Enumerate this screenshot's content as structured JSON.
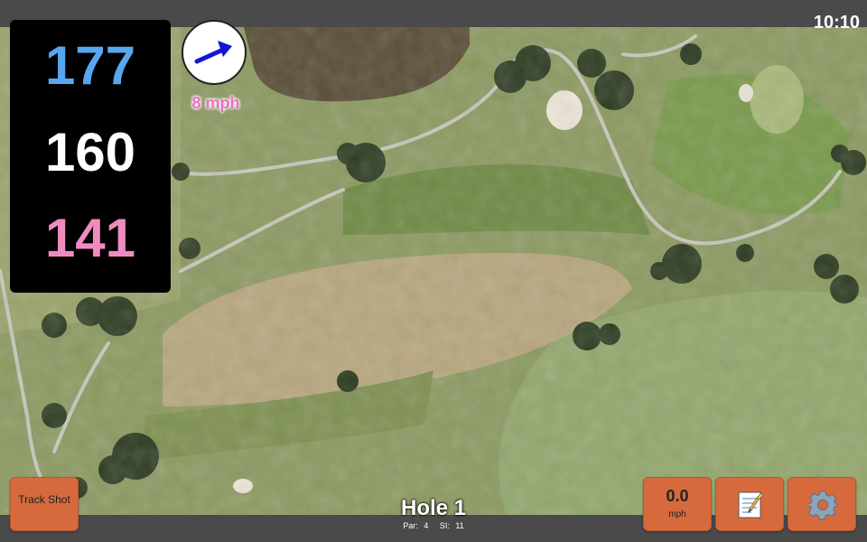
{
  "status_bar": {
    "time": "10:10"
  },
  "distances": {
    "back": "177",
    "middle": "160",
    "front": "141"
  },
  "wind": {
    "speed": "8 mph",
    "direction_icon": "arrow-east-northeast"
  },
  "hole": {
    "title": "Hole 1",
    "par": "Par: 4",
    "stroke_index": "SI: 11"
  },
  "buttons": {
    "track_shot": "Track Shot",
    "speed_value": "0.0",
    "speed_unit": "mph",
    "notes_icon": "memo-icon",
    "settings_icon": "gear-icon"
  },
  "colors": {
    "back_distance": "#5aa6ee",
    "middle_distance": "#ffffff",
    "front_distance": "#f08ac0",
    "wind_text": "#ec6fc4",
    "button": "#d66a3c",
    "wind_arrow": "#1414d8"
  }
}
